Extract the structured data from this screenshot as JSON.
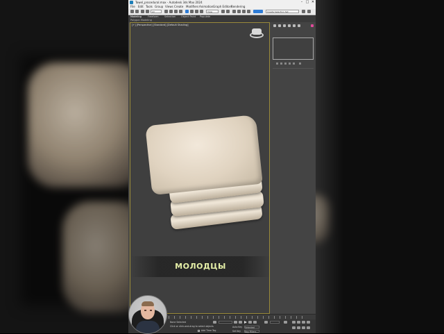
{
  "window": {
    "title": "Towel_procedural.max - Autodesk 3ds Max 2024",
    "buttons": [
      "–",
      "□",
      "✕"
    ]
  },
  "menu": {
    "items": [
      "File",
      "Edit",
      "Tools",
      "Group",
      "Views",
      "Create",
      "Modifiers",
      "Animation",
      "Graph Editors",
      "Rendering"
    ]
  },
  "toolbar": {
    "selection_filter": "All",
    "view_dropdown": "View",
    "named_selection": "Create Selection Set"
  },
  "ribbon": {
    "tabs": [
      "Modeling",
      "Freeform",
      "Selection",
      "Object Paint",
      "Populate"
    ],
    "subtitle": "Polygon Modeling"
  },
  "viewport": {
    "label": "[+] [Perspective] [Standard] [Default Shading]",
    "caption": "МОЛОДЦЫ"
  },
  "statusbar": {
    "prompt": "Click or click-and-drag to select objects",
    "selected": "None Selected",
    "add_time_tag": "Add Time Tag",
    "autokey": "Auto Key",
    "selected_mode": "Selected",
    "set_key": "Set Key",
    "key_filters": "Key Filters..."
  },
  "colors": {
    "app_bg": "#444444",
    "viewport_border": "#9a8a3a",
    "caption_text": "#e6f0a8",
    "accent_pink": "#e04a9a"
  }
}
